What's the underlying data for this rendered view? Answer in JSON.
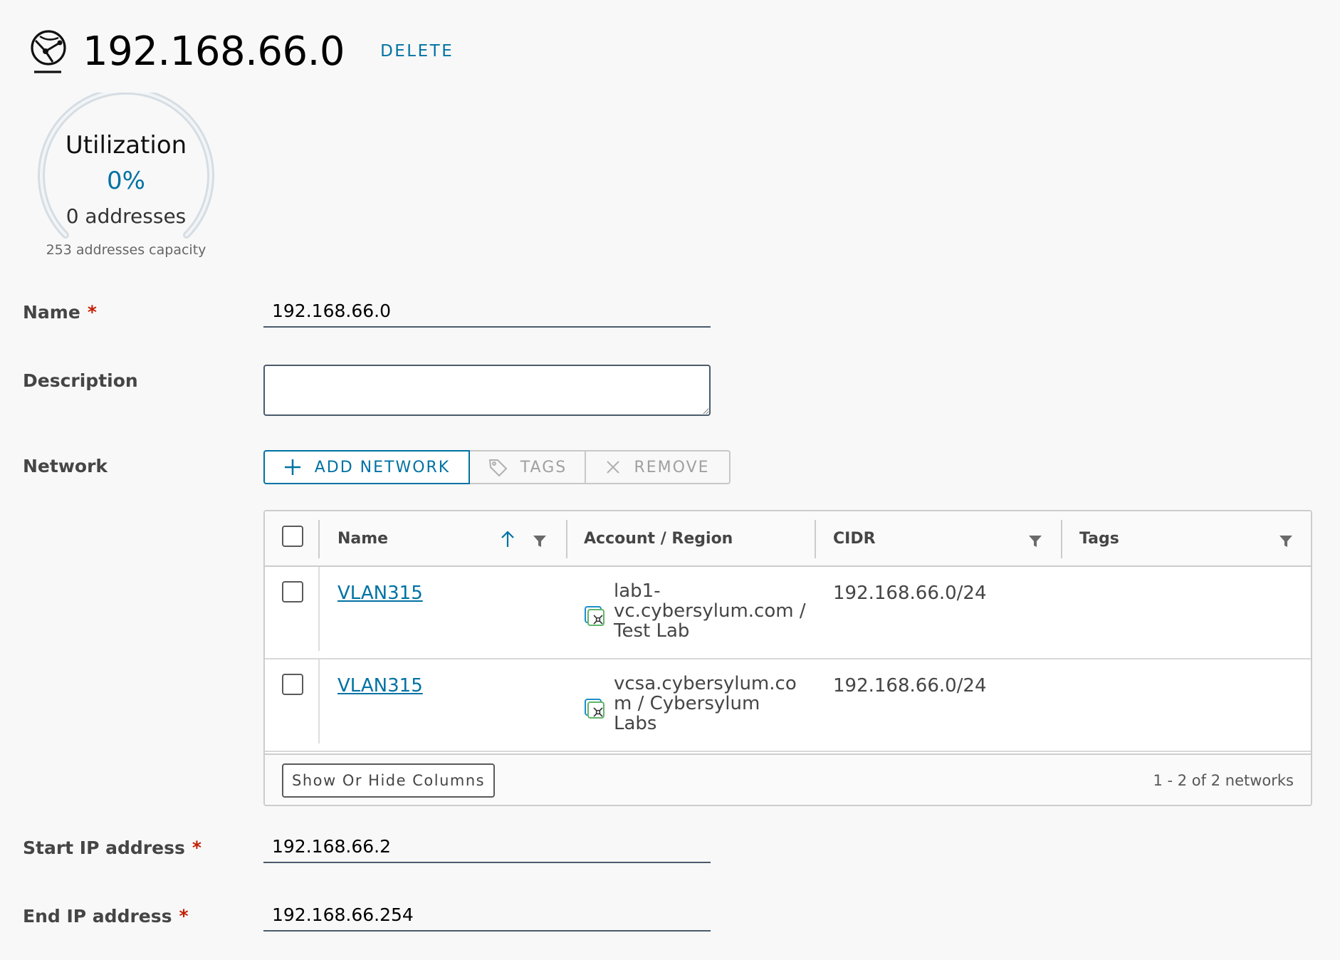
{
  "header": {
    "title": "192.168.66.0",
    "delete_label": "DELETE",
    "icon": "network-globe-icon"
  },
  "utilization": {
    "label": "Utilization",
    "percent": "0%",
    "addresses": "0 addresses",
    "capacity": "253 addresses capacity",
    "fraction": 0
  },
  "form": {
    "name_label": "Name",
    "name_value": "192.168.66.0",
    "description_label": "Description",
    "description_value": "",
    "network_label": "Network",
    "start_ip_label": "Start IP address",
    "start_ip_value": "192.168.66.2",
    "end_ip_label": "End IP address",
    "end_ip_value": "192.168.66.254",
    "required_marker": "*"
  },
  "network_toolbar": {
    "add_label": "ADD NETWORK",
    "tags_label": "TAGS",
    "remove_label": "REMOVE"
  },
  "grid": {
    "columns": {
      "name": "Name",
      "account_region": "Account / Region",
      "cidr": "CIDR",
      "tags": "Tags"
    },
    "rows": [
      {
        "name": "VLAN315",
        "account_region": "lab1-\nvc.cybersylum.com /\nTest Lab",
        "cidr": "192.168.66.0/24",
        "tags": ""
      },
      {
        "name": "VLAN315",
        "account_region": "vcsa.cybersylum.co\nm / Cybersylum\nLabs",
        "cidr": "192.168.66.0/24",
        "tags": ""
      }
    ],
    "footer_button": "Show Or Hide Columns",
    "pagination": "1 - 2 of 2 networks"
  },
  "colors": {
    "accent": "#0072a3",
    "required": "#c21d00",
    "background": "#f8f8f8"
  }
}
